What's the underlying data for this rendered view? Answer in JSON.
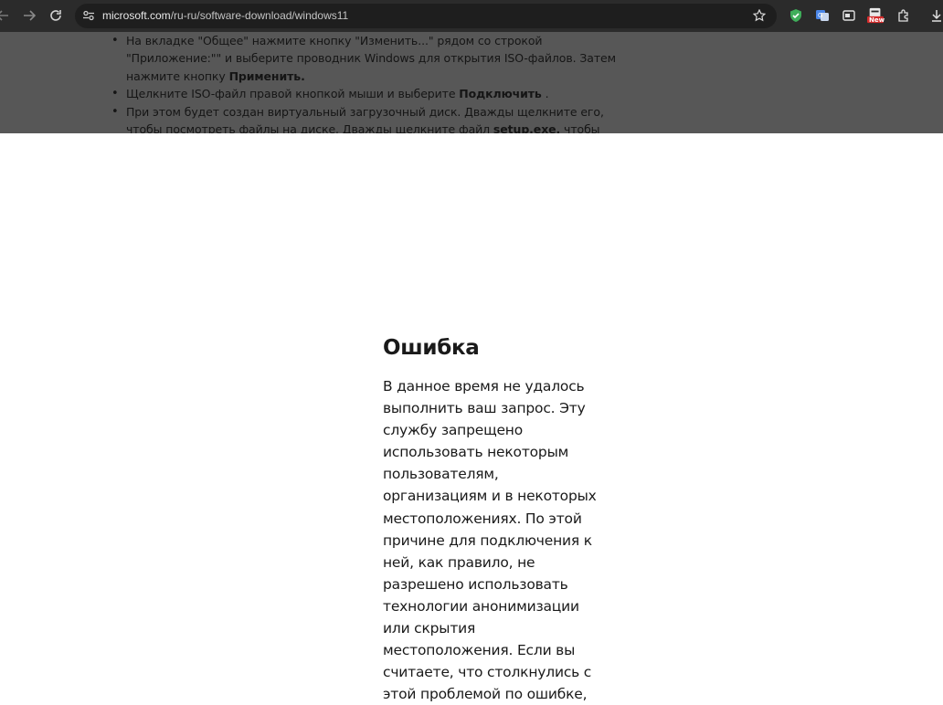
{
  "browser": {
    "url_domain": "microsoft.com",
    "url_path": "/ru-ru/software-download/windows11",
    "extension_badge": "New",
    "icons": [
      "back-icon",
      "forward-icon",
      "reload-icon",
      "site-settings-icon",
      "bookmark-star-icon",
      "shield-extension-icon",
      "translate-extension-icon",
      "window-extension-icon",
      "new-badge-extension-icon",
      "extensions-puzzle-icon",
      "download-icon"
    ]
  },
  "instructions": {
    "item1_a": "На вкладке \"Общее\" нажмите кнопку \"Изменить...\" рядом со строкой \"Приложение:\"\" и выберите проводник Windows для открытия ISO-файлов. Затем нажмите кнопку ",
    "item1_b": "Применить.",
    "item2_a": "Щелкните ISO-файл правой кнопкой мыши и выберите ",
    "item2_b": "Подключить",
    "item2_c": " .",
    "item3_a": "При этом будет создан виртуальный загрузочный диск. Дважды щелкните его, чтобы посмотреть файлы на диске. Дважды щелкните файл ",
    "item3_b": "setup.exe,",
    "item3_c": " чтобы начать установку"
  },
  "error": {
    "title": "Ошибка",
    "message": "В данное время не удалось выполнить ваш запрос. Эту службу запрещено использовать некоторым пользователям, организациям и в некоторых местоположениях. По этой причине для подключения к ней, как правило, не разрешено использовать технологии анонимизации или скрытия местоположения. Если вы считаете, что столкнулись с этой проблемой по ошибке,"
  }
}
